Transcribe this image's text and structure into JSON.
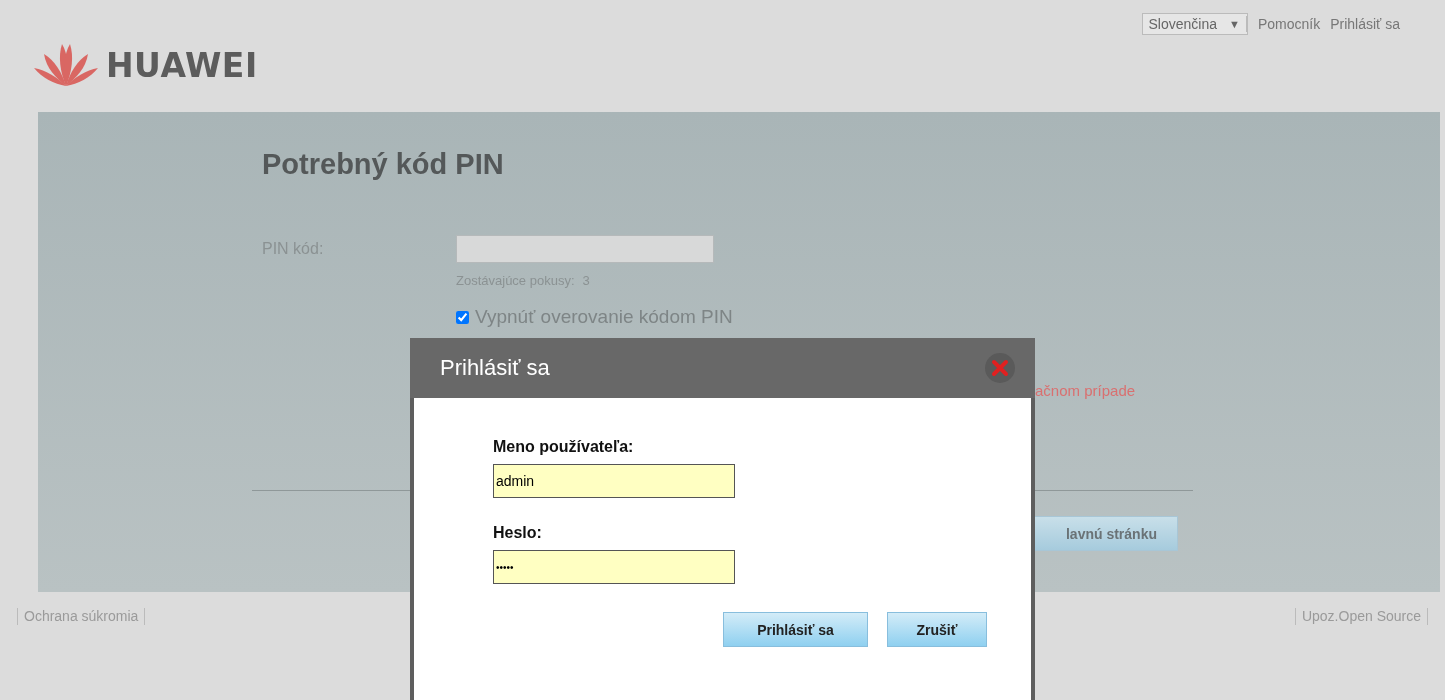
{
  "header": {
    "logo_text": "HUAWEI",
    "language": {
      "value": "Slovenčina",
      "arrow": "▼"
    },
    "links": [
      "Pomocník",
      "Prihlásiť sa"
    ]
  },
  "pin_page": {
    "title": "Potrebný kód PIN",
    "pin_label": "PIN kód:",
    "attempts_label": "Zostávajúce pokusy:",
    "attempts": "3",
    "disable_pin": {
      "label": "Vypnúť overovanie kódom PIN",
      "checked": true
    },
    "warning_fragment": "ačnom prípade",
    "home_button_fragment": "lavnú stránku"
  },
  "login_dialog": {
    "title": "Prihlásiť sa",
    "username_label": "Meno používateľa:",
    "username": "admin",
    "password_label": "Heslo:",
    "password": "•••••",
    "buttons": [
      "Prihlásiť sa",
      "Zrušiť"
    ]
  },
  "footer": {
    "links": [
      "Ochrana súkromia",
      "Upoz.Open Source"
    ]
  }
}
